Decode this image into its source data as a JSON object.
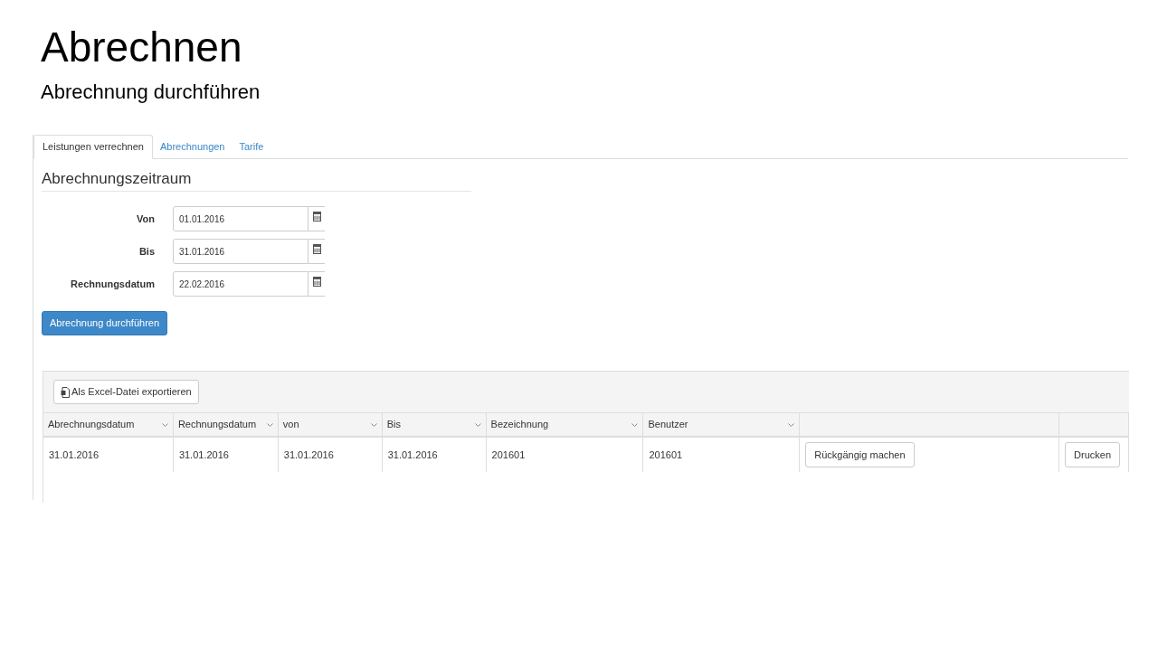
{
  "slide": {
    "title": "Abrechnen",
    "subtitle": "Abrechnung durchführen"
  },
  "tabs": [
    {
      "label": "Leistungen verrechnen",
      "selected": true
    },
    {
      "label": "Abrechnungen",
      "selected": false
    },
    {
      "label": "Tarife",
      "selected": false
    }
  ],
  "section_title": "Abrechnungszeitraum",
  "fields": [
    {
      "label": "Von",
      "value": "01.01.2016"
    },
    {
      "label": "Bis",
      "value": "31.01.2016"
    },
    {
      "label": "Rechnungsdatum",
      "value": "22.02.2016"
    }
  ],
  "submit_button": "Abrechnung durchführen",
  "grid": {
    "export_button": "Als Excel-Datei exportieren",
    "columns": [
      {
        "kind": "sort",
        "label": "Abrechnungsdatum"
      },
      {
        "kind": "sort",
        "label": "Rechnungsdatum"
      },
      {
        "kind": "sort",
        "label": "von"
      },
      {
        "kind": "sort",
        "label": "Bis"
      },
      {
        "kind": "sort",
        "label": "Bezeichnung"
      },
      {
        "kind": "sort",
        "label": "Benutzer"
      },
      {
        "kind": "action"
      },
      {
        "kind": "action"
      }
    ],
    "rows": [
      {
        "cells": [
          {
            "kind": "text",
            "text": "31.01.2016"
          },
          {
            "kind": "text",
            "text": "31.01.2016"
          },
          {
            "kind": "text",
            "text": "31.01.2016"
          },
          {
            "kind": "text",
            "text": "31.01.2016"
          },
          {
            "kind": "text",
            "text": "201601"
          },
          {
            "kind": "text",
            "text": "201601"
          },
          {
            "kind": "button",
            "text": "Rückgängig machen"
          },
          {
            "kind": "button",
            "text": "Drucken"
          }
        ]
      }
    ]
  }
}
